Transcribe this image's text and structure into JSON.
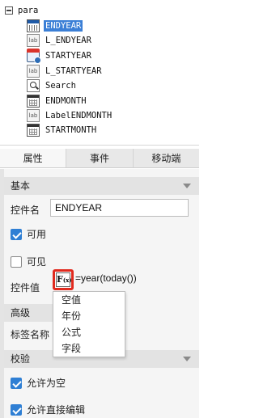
{
  "tree": {
    "root_label": "para",
    "items": [
      {
        "label": "ENDYEAR",
        "icon": "calendar-icon",
        "selected": true
      },
      {
        "label": "L_ENDYEAR",
        "icon": "label-icon",
        "selected": false
      },
      {
        "label": "STARTYEAR",
        "icon": "date-icon",
        "selected": false
      },
      {
        "label": "L_STARTYEAR",
        "icon": "label-icon",
        "selected": false
      },
      {
        "label": "Search",
        "icon": "search-icon",
        "selected": false
      },
      {
        "label": "ENDMONTH",
        "icon": "month-icon",
        "selected": false
      },
      {
        "label": "LabelENDMONTH",
        "icon": "label-icon",
        "selected": false
      },
      {
        "label": "STARTMONTH",
        "icon": "month-icon",
        "selected": false
      }
    ],
    "label_icon_text": "lab"
  },
  "tabs": [
    {
      "label": "属性",
      "active": true
    },
    {
      "label": "事件",
      "active": false
    },
    {
      "label": "移动端",
      "active": false
    }
  ],
  "sections": {
    "basic": "基本",
    "advanced": "高级",
    "validate": "校验"
  },
  "fields": {
    "widget_name_label": "控件名",
    "widget_name_value": "ENDYEAR",
    "enabled_label": "可用",
    "visible_label": "可见",
    "widget_value_label": "控件值",
    "formula_value": "=year(today())",
    "tag_name_label": "标签名称",
    "allow_empty_label": "允许为空",
    "allow_direct_edit_label": "允许直接编辑"
  },
  "formula_button": {
    "glyph": "F",
    "sub": "(x)"
  },
  "dropdown_options": [
    "空值",
    "年份",
    "公式",
    "字段"
  ],
  "colors": {
    "selection": "#3b7fd6",
    "highlight_border": "#e02a1e",
    "checkbox_on": "#2f7fd4"
  }
}
